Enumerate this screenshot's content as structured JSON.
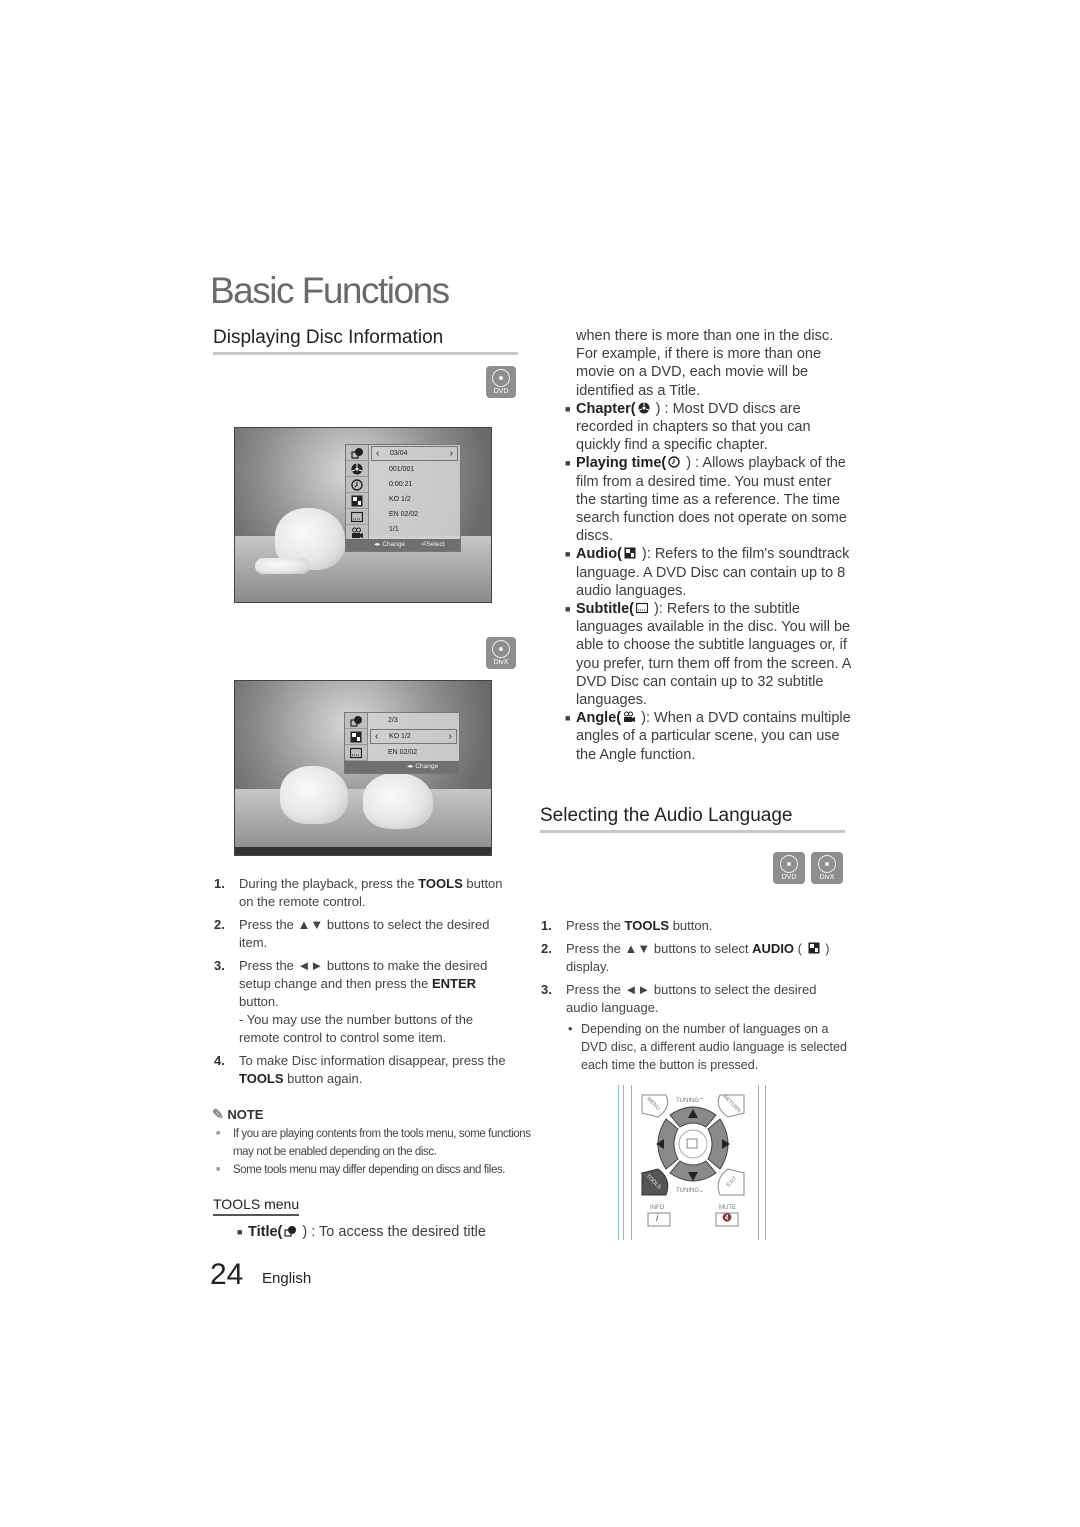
{
  "chapter_title": "Basic Functions",
  "section1": {
    "title": "Displaying Disc Information",
    "badge_dvd": "DVD",
    "badge_divx": "DivX",
    "osd_dvd": {
      "icons": [
        "title-icon",
        "chapter-icon",
        "time-icon",
        "audio-icon",
        "subtitle-icon",
        "angle-icon"
      ],
      "rows": [
        "03/04",
        "001/001",
        "0:00:21",
        "KO 1/2",
        "EN 02/02",
        "1/1"
      ],
      "selected_row": 0,
      "footer_change": "◂▸ Change",
      "footer_select": "Select"
    },
    "osd_divx": {
      "icons": [
        "title-icon",
        "audio-icon",
        "subtitle-icon"
      ],
      "rows": [
        "2/3",
        "KO 1/2",
        "EN 02/02"
      ],
      "selected_row": 1,
      "footer_change": "◂▸ Change"
    },
    "steps": [
      {
        "num": "1.",
        "parts": [
          "During the playback, press the ",
          "TOOLS",
          " button on the remote control."
        ]
      },
      {
        "num": "2.",
        "parts": [
          "Press the ▲▼ buttons to select the desired item."
        ]
      },
      {
        "num": "3.",
        "parts": [
          "Press the ◄► buttons to make the desired setup change and then press the ",
          "ENTER",
          " button."
        ],
        "sub": "- You may use the number buttons of the remote control to control some item."
      },
      {
        "num": "4.",
        "parts": [
          "To make Disc information disappear, press the ",
          "TOOLS",
          " button again."
        ]
      }
    ],
    "note": {
      "label": "NOTE",
      "items": [
        "If you are playing contents from the tools menu, some functions may not be enabled depending on the disc.",
        "Some tools menu may differ depending on discs and files."
      ]
    },
    "tools_menu": {
      "heading": "TOOLS menu",
      "title_item": {
        "term": "Title(",
        "close": " ) : To access the desired title"
      },
      "continuation": "when there is more than one in the disc. For example, if there is more than one movie on a DVD, each movie will be identified as a Title.",
      "items": [
        {
          "term": "Chapter(",
          "icon": "chapter-icon",
          "text": " ) : Most DVD discs are recorded in chapters so that you can quickly find a specific chapter."
        },
        {
          "term": "Playing time(",
          "icon": "time-icon",
          "text": " ) : Allows playback of the film from a desired time. You must enter the starting time as a reference. The time search function does not operate on some discs."
        },
        {
          "term": "Audio(",
          "icon": "audio-icon",
          "text": " ): Refers to the film's soundtrack language. A DVD Disc can contain up to 8 audio languages."
        },
        {
          "term": "Subtitle(",
          "icon": "subtitle-icon",
          "text": " ): Refers to the subtitle languages available in the disc. You will be able to choose the subtitle languages or, if you prefer, turn them off from the screen. A DVD Disc can contain up to 32 subtitle languages."
        },
        {
          "term": "Angle(",
          "icon": "angle-icon",
          "text": " ): When a DVD contains multiple angles of a particular scene, you can use the Angle function."
        }
      ]
    }
  },
  "section2": {
    "title": "Selecting the Audio Language",
    "badges": [
      "DVD",
      "DivX"
    ],
    "steps": [
      {
        "num": "1.",
        "parts": [
          "Press the ",
          "TOOLS",
          " button."
        ]
      },
      {
        "num": "2.",
        "parts": [
          "Press the ▲▼ buttons to select ",
          "AUDIO",
          " ( ",
          "",
          " ) display."
        ]
      },
      {
        "num": "3.",
        "parts": [
          "Press the ◄► buttons to select the desired audio language."
        ]
      }
    ],
    "bullet": "Depending on the number of languages on a DVD disc, a different audio language is selected each time the button is pressed.",
    "remote": {
      "menu": "MENU",
      "tuning_up": "TUNING⌃",
      "return": "RETURN",
      "tools": "TOOLS",
      "tuning_down": "TUNING⌄",
      "exit": "EXIT",
      "info": "INFO",
      "info_glyph": "i",
      "mute": "MUTE",
      "mute_glyph": "🔇"
    }
  },
  "footer": {
    "page_number": "24",
    "language": "English"
  }
}
